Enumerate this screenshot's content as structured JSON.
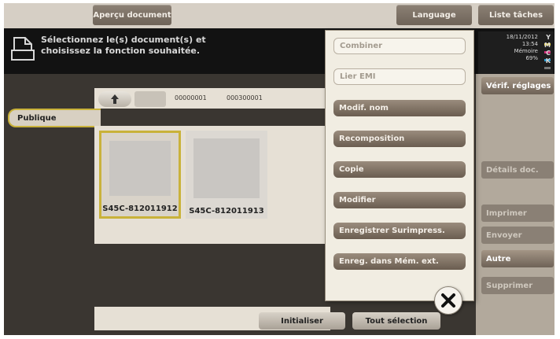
{
  "topbar": {
    "preview_label": "Aperçu document",
    "language_label": "Language",
    "joblist_label": "Liste tâches"
  },
  "message": {
    "text": "Sélectionnez le(s) document(s) et choisissez la fonction souhaitée."
  },
  "status": {
    "date": "18/11/2012",
    "time": "13:54",
    "memory_label": "Mémoire",
    "memory_value": "69%",
    "toners": [
      {
        "letter": "Y",
        "color": "#e8d02a"
      },
      {
        "letter": "M",
        "color": "#d0307a"
      },
      {
        "letter": "C",
        "color": "#2a9ad0"
      },
      {
        "letter": "K",
        "color": "#222222"
      }
    ]
  },
  "left": {
    "tab_label": "Publique"
  },
  "breadcrumb": {
    "box": "00000001",
    "folder": "000300001"
  },
  "documents": [
    {
      "name": "S45C-812011912",
      "selected": true
    },
    {
      "name": "S45C-812011913",
      "selected": false
    }
  ],
  "bottom": {
    "reset_label": "Initialiser",
    "select_all_label": "Tout sélection"
  },
  "menu": {
    "items": [
      {
        "label": "Combiner",
        "enabled": false
      },
      {
        "label": "Lier EMI",
        "enabled": false
      },
      {
        "label": "Modif. nom",
        "enabled": true
      },
      {
        "label": "Recomposition",
        "enabled": true
      },
      {
        "label": "Copie",
        "enabled": true
      },
      {
        "label": "Modifier",
        "enabled": true
      },
      {
        "label": "Enregistrer Surimpress.",
        "enabled": true
      },
      {
        "label": "Enreg. dans Mém. ext.",
        "enabled": true
      }
    ]
  },
  "right": {
    "check_settings_label": "Vérif. réglages",
    "doc_details_label": "Détails doc.",
    "print_label": "Imprimer",
    "send_label": "Envoyer",
    "other_label": "Autre",
    "delete_label": "Supprimer"
  }
}
